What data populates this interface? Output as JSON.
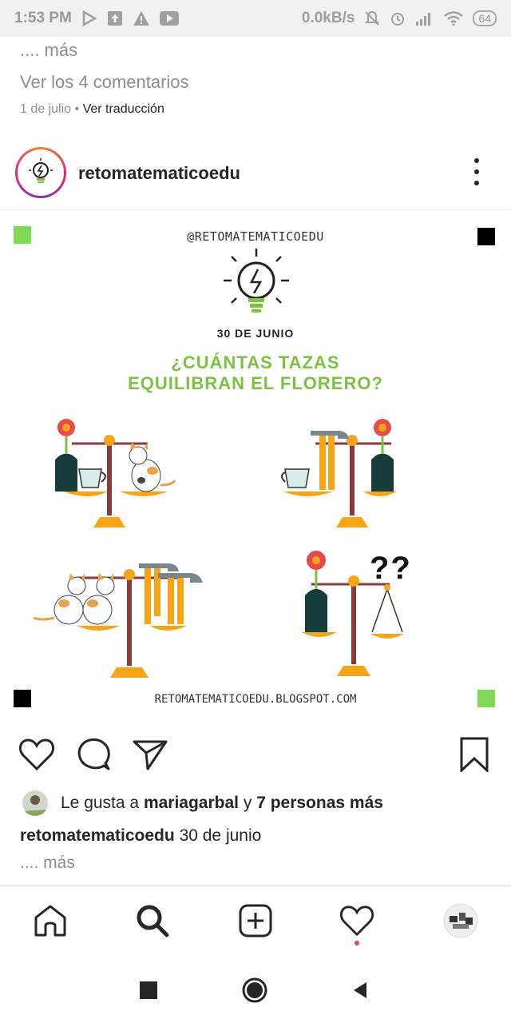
{
  "status_bar": {
    "time": "1:53 PM",
    "network_speed": "0.0kB/s",
    "battery": "64",
    "icons": [
      "play-store-icon",
      "upload-icon",
      "warning-icon",
      "youtube-icon",
      "mute-icon",
      "alarm-icon",
      "signal-icon",
      "wifi-icon",
      "battery-icon"
    ]
  },
  "previous_post": {
    "more": ".... más",
    "view_comments": "Ver los 4 comentarios",
    "date": "1 de julio",
    "separator": "•",
    "translate": "Ver traducción"
  },
  "post": {
    "username": "retomatematicoedu",
    "avatar_icon": "lightbulb-icon",
    "image": {
      "handle": "@RETOMATEMATICOEDU",
      "date": "30 DE JUNIO",
      "question_line1": "¿CUÁNTAS TAZAS",
      "question_line2": "EQUILIBRAN EL FLORERO?",
      "unknown": "??",
      "blog": "RETOMATEMATICOEDU.BLOGSPOT.COM",
      "accent_color": "#7cc242",
      "scale_color": "#f5a516"
    },
    "actions": [
      "heart-icon",
      "comment-icon",
      "share-icon",
      "bookmark-icon"
    ],
    "likes": {
      "prefix": "Le gusta a",
      "user": "mariagarbal",
      "conjunction": "y",
      "others": "7 personas más"
    },
    "caption": {
      "username": "retomatematicoedu",
      "text": "30 de junio",
      "more": ".... más"
    }
  },
  "bottom_nav": {
    "items": [
      "home-icon",
      "search-icon",
      "new-post-icon",
      "activity-icon",
      "profile-avatar"
    ]
  },
  "system_nav": {
    "items": [
      "recents-button",
      "home-button",
      "back-button"
    ]
  }
}
